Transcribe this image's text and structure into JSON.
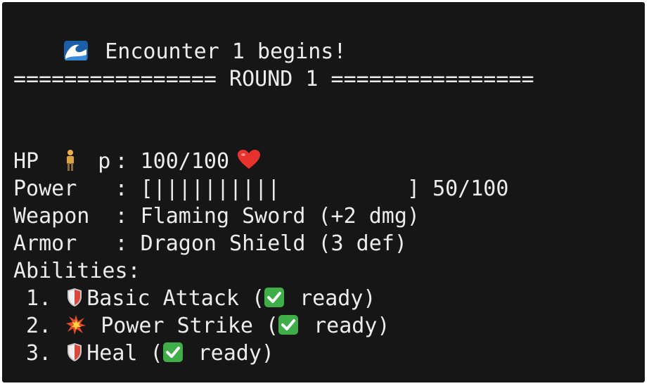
{
  "header": {
    "encounter_text": "Encounter 1 begins!",
    "wave_icon": "water-wave-icon",
    "round_banner": "================ ROUND 1 ================"
  },
  "player": {
    "icon": "person-icon",
    "name": "p",
    "hp_label": "HP      : ",
    "hp_value": "100/100",
    "hp_icon": "red-heart-icon",
    "power_label": "Power   : ",
    "power_bar_open": "[",
    "power_bar_fill": "||||||||||",
    "power_bar_close": "]",
    "power_fraction": 0.5,
    "power_value": "50/100",
    "weapon_label": "Weapon  : ",
    "weapon_value": "Flaming Sword (+2 dmg)",
    "armor_label": "Armor   : ",
    "armor_value": "Dragon Shield (3 def)",
    "abilities_label": "Abilities:"
  },
  "abilities": [
    {
      "number": " 1. ",
      "icon": "shield-icon",
      "name": "Basic Attack",
      "status_open": " (",
      "status_icon": "check-mark-icon",
      "status": "ready)"
    },
    {
      "number": " 2. ",
      "icon": "collision-icon",
      "name": "Power Strike",
      "status_open": " (",
      "status_icon": "check-mark-icon",
      "status": "ready)"
    },
    {
      "number": " 3. ",
      "icon": "shield-icon",
      "name": "Heal",
      "status_open": " (",
      "status_icon": "check-mark-icon",
      "status": "ready)"
    }
  ],
  "colors": {
    "background": "#161616",
    "text": "#ececec",
    "heart": "#e8322e",
    "check": "#3fae49"
  }
}
